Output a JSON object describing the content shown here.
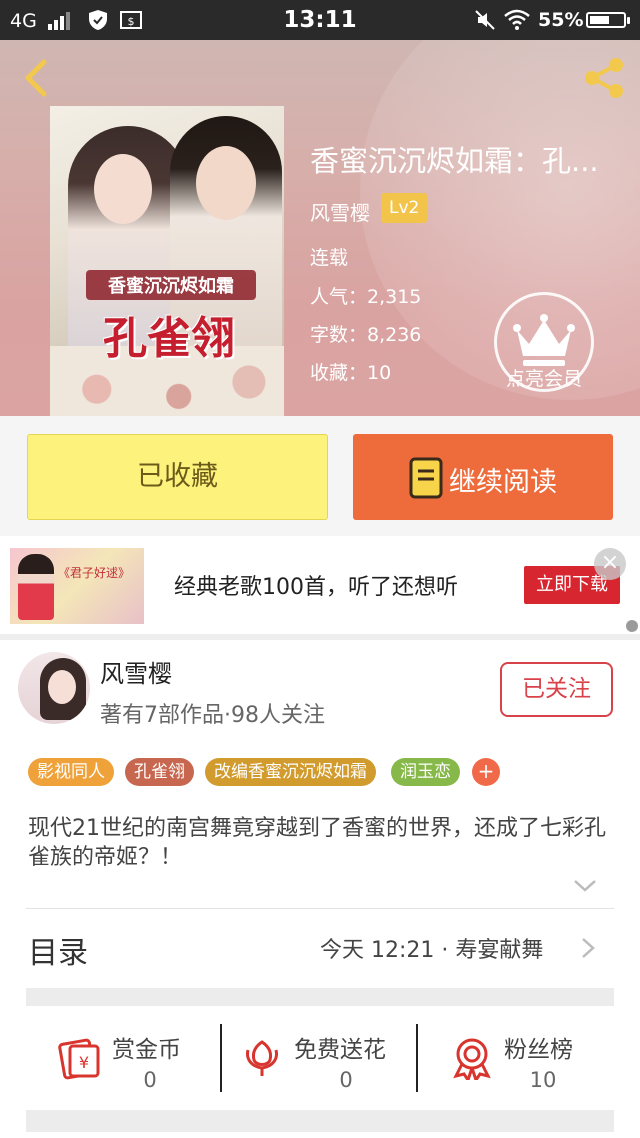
{
  "status_bar": {
    "network": "4G",
    "time": "13:11",
    "battery": "55%"
  },
  "book": {
    "title": "香蜜沉沉烬如霜：孔...",
    "cover_title_small": "香蜜沉沉烬如霜",
    "cover_title_big": "孔雀翎",
    "author": "风雪樱",
    "author_level": "Lv2",
    "status": "连载",
    "popularity": "人气：2,315",
    "word_count": "字数：8,236",
    "favorites": "收藏：10",
    "vip_label": "点亮会员"
  },
  "actions": {
    "favorited_label": "已收藏",
    "continue_label": "继续阅读"
  },
  "ad": {
    "thumb_text": "《君子好逑》",
    "text": "经典老歌100首，听了还想听",
    "cta": "立即下载",
    "close": "×"
  },
  "author_card": {
    "name": "风雪樱",
    "stats": "著有7部作品·98人关注",
    "follow_label": "已关注"
  },
  "tags": [
    {
      "label": "影视同人",
      "color": "#f0a23a"
    },
    {
      "label": "孔雀翎",
      "color": "#c8674f"
    },
    {
      "label": "改编香蜜沉沉烬如霜",
      "color": "#d29b2e"
    },
    {
      "label": "润玉恋",
      "color": "#86b84a"
    }
  ],
  "tag_more": "+",
  "description": "现代21世纪的南宫舞竟穿越到了香蜜的世界，还成了七彩孔雀族的帝姬？！",
  "toc": {
    "label": "目录",
    "latest": "今天 12:21 · 寿宴献舞"
  },
  "stats": [
    {
      "label": "赏金币",
      "value": "0",
      "icon": "red-envelope-icon"
    },
    {
      "label": "免费送花",
      "value": "0",
      "icon": "flower-icon"
    },
    {
      "label": "粉丝榜",
      "value": "10",
      "icon": "medal-icon"
    }
  ],
  "colors": {
    "accent_orange": "#ee6b3b",
    "fav_yellow": "#fdf27b",
    "follow_red": "#d8434a",
    "icon_red": "#d8352e"
  }
}
